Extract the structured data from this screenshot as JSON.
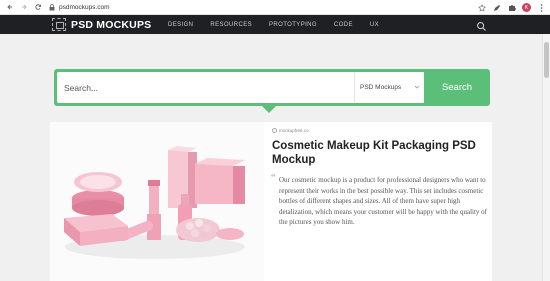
{
  "browser": {
    "url": "psdmockups.com",
    "avatar_letter": "K"
  },
  "site": {
    "logo_text": "PSD MOCKUPS",
    "nav": [
      "DESIGN",
      "RESOURCES",
      "PROTOTYPING",
      "CODE",
      "UX"
    ]
  },
  "search": {
    "placeholder": "Search...",
    "category": "PSD Mockups",
    "button_label": "Search",
    "accent": "#5bbf7a"
  },
  "card": {
    "source": "mockupfree.co",
    "title": "Cosmetic Makeup Kit Packaging PSD Mockup",
    "description": "Our cosmetic mockup is a product for professional designers who want to represent their works in the best possible way. This set includes cosmetic bottles of different shapes and sizes. All of them have super high detalization, which means your customer will be happy with the quality of the pictures you show him.",
    "image_label": "Cosmetic Makeup Kit"
  },
  "colors": {
    "header_bg": "#1e2024",
    "product_pink": "#f2a7ba"
  }
}
